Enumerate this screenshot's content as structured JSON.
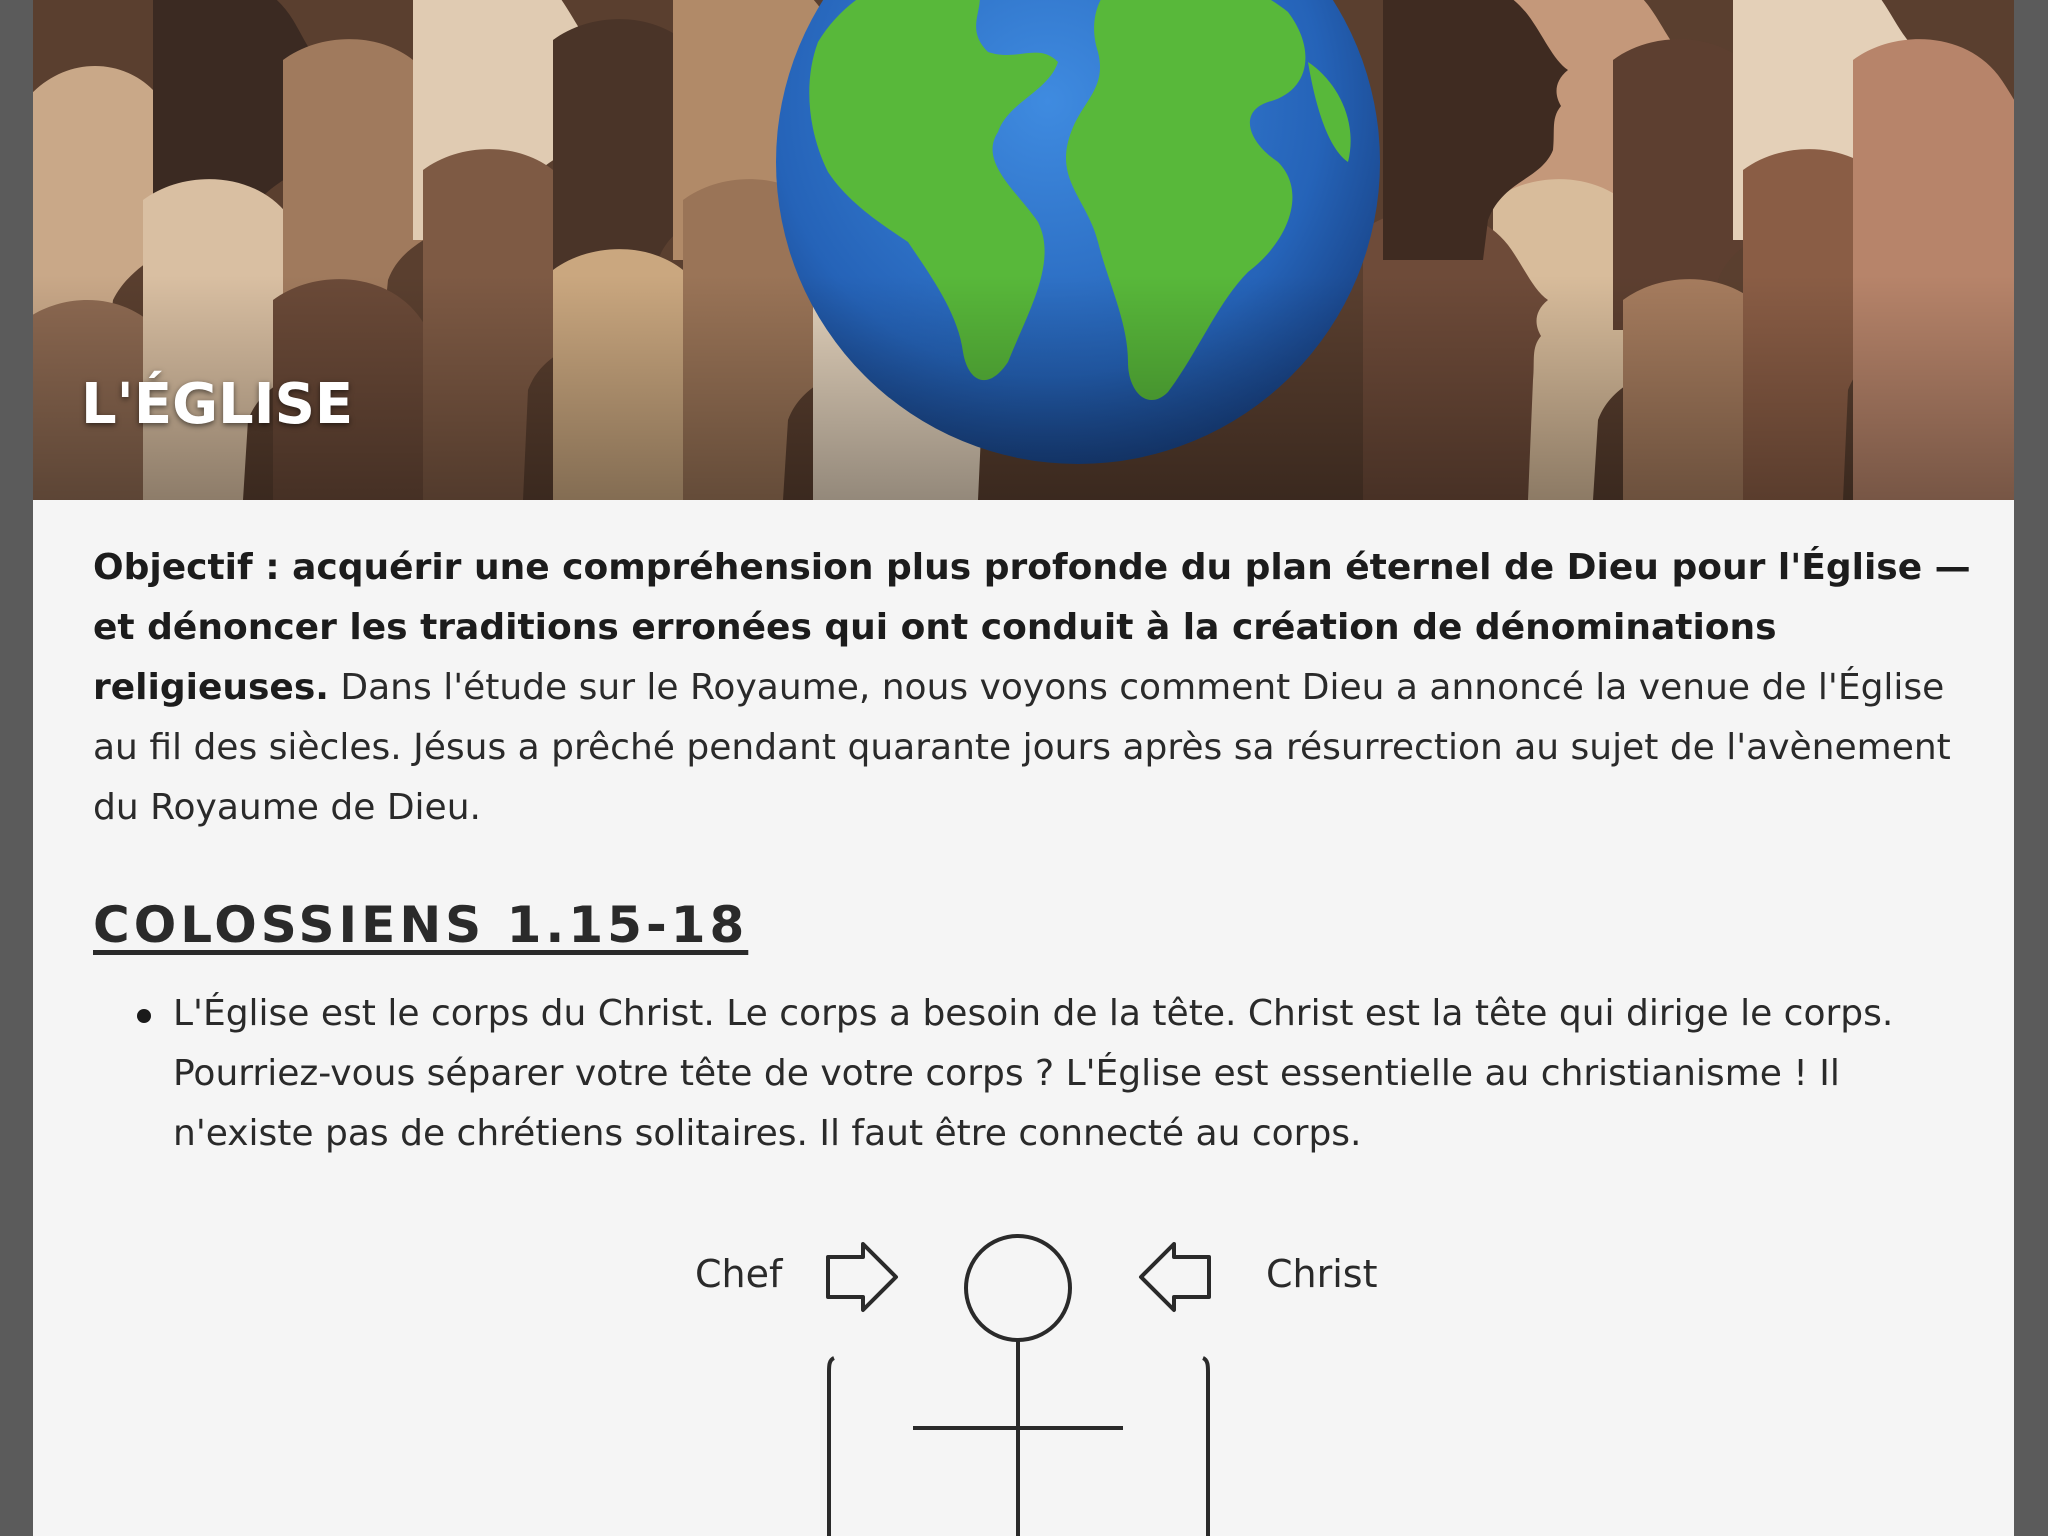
{
  "hero": {
    "title": "L'ÉGLISE"
  },
  "intro": {
    "objective_bold": "Objectif : acquérir une compréhension plus profonde du plan éternel de Dieu pour l'Église — et dénoncer les traditions erronées qui ont conduit à la création de dénominations religieuses.",
    "body": " Dans l'étude sur le Royaume, nous voyons comment Dieu a annoncé la venue de l'Église au fil des siècles. Jésus a prêché pendant quarante jours après sa résurrection au sujet de l'avènement du Royaume de Dieu."
  },
  "section": {
    "heading": "COLOSSIENS 1.15-18",
    "bullets": [
      "L'Église est le corps du Christ. Le corps a besoin de la tête. Christ est la tête qui dirige le corps. Pourriez-vous séparer votre tête de votre corps ? L'Église est essentielle au christianisme ! Il n'existe pas de chrétiens solitaires. Il faut être connecté au corps."
    ]
  },
  "diagram": {
    "left_label": "Chef",
    "right_label": "Christ"
  },
  "colors": {
    "page_bg": "#f5f5f5",
    "frame_bg": "#5b5b5b",
    "text": "#2a2a2a",
    "ocean": "#2e6fc4",
    "land": "#5bbf3a"
  }
}
